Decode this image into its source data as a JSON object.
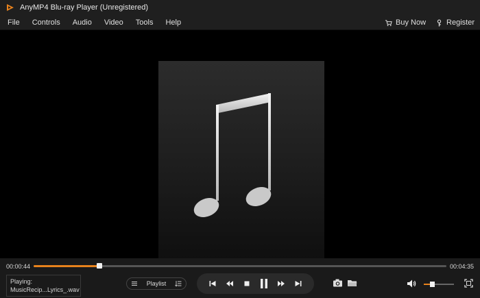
{
  "window": {
    "title": "AnyMP4 Blu-ray Player (Unregistered)"
  },
  "menu": {
    "items": [
      "File",
      "Controls",
      "Audio",
      "Video",
      "Tools",
      "Help"
    ],
    "buy_now": "Buy Now",
    "register": "Register"
  },
  "player": {
    "elapsed": "00:00:44",
    "duration": "00:04:35",
    "progress_fraction": 0.16,
    "now_playing_label": "Playing:",
    "now_playing_file": "MusicRecip...Lyrics_.wav",
    "playlist_label": "Playlist",
    "volume_fraction": 0.2
  },
  "colors": {
    "accent": "#e8821c",
    "chrome": "#1f1f1f"
  },
  "icons": {
    "logo": "play-triangle-icon",
    "buy": "cart-icon",
    "register": "key-icon",
    "art": "music-note-icon"
  }
}
